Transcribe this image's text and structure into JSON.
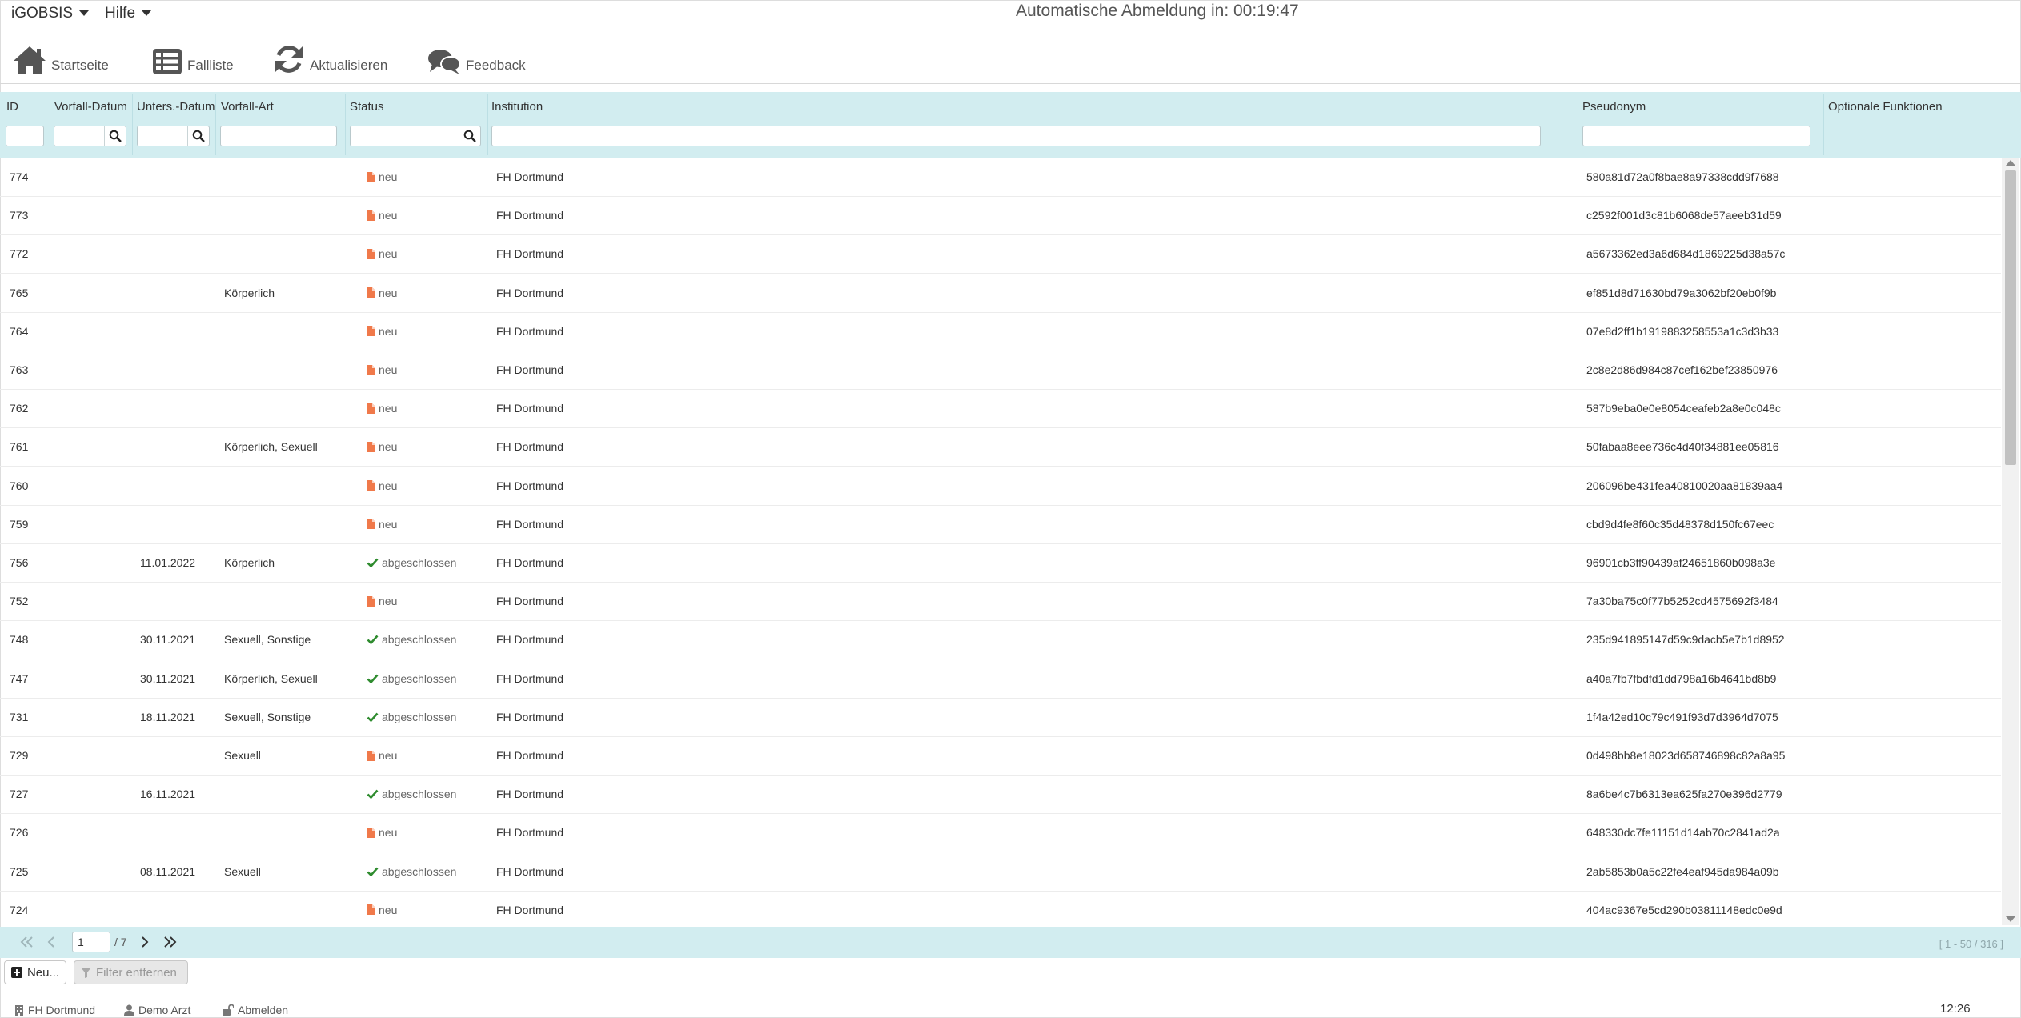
{
  "menubar": {
    "app_menu": "iGOBSIS",
    "help_menu": "Hilfe",
    "logout_timer": "Automatische Abmeldung in: 00:19:47"
  },
  "toolbar": {
    "home": "Startseite",
    "caselist": "Fallliste",
    "refresh": "Aktualisieren",
    "feedback": "Feedback"
  },
  "table": {
    "headers": {
      "id": "ID",
      "vorfall_datum": "Vorfall-Datum",
      "unters_datum": "Unters.-Datum",
      "vorfall_art": "Vorfall-Art",
      "status": "Status",
      "institution": "Institution",
      "pseudonym": "Pseudonym",
      "optionale": "Optionale Funktionen"
    },
    "rows": [
      {
        "id": "774",
        "vorfall": "",
        "unters": "",
        "art": "",
        "status": "neu",
        "status_type": "new",
        "institution": "FH Dortmund",
        "pseudonym": "580a81d72a0f8bae8a97338cdd9f7688"
      },
      {
        "id": "773",
        "vorfall": "",
        "unters": "",
        "art": "",
        "status": "neu",
        "status_type": "new",
        "institution": "FH Dortmund",
        "pseudonym": "c2592f001d3c81b6068de57aeeb31d59"
      },
      {
        "id": "772",
        "vorfall": "",
        "unters": "",
        "art": "",
        "status": "neu",
        "status_type": "new",
        "institution": "FH Dortmund",
        "pseudonym": "a5673362ed3a6d684d1869225d38a57c"
      },
      {
        "id": "765",
        "vorfall": "",
        "unters": "",
        "art": "Körperlich",
        "status": "neu",
        "status_type": "new",
        "institution": "FH Dortmund",
        "pseudonym": "ef851d8d71630bd79a3062bf20eb0f9b"
      },
      {
        "id": "764",
        "vorfall": "",
        "unters": "",
        "art": "",
        "status": "neu",
        "status_type": "new",
        "institution": "FH Dortmund",
        "pseudonym": "07e8d2ff1b1919883258553a1c3d3b33"
      },
      {
        "id": "763",
        "vorfall": "",
        "unters": "",
        "art": "",
        "status": "neu",
        "status_type": "new",
        "institution": "FH Dortmund",
        "pseudonym": "2c8e2d86d984c87cef162bef23850976"
      },
      {
        "id": "762",
        "vorfall": "",
        "unters": "",
        "art": "",
        "status": "neu",
        "status_type": "new",
        "institution": "FH Dortmund",
        "pseudonym": "587b9eba0e0e8054ceafeb2a8e0c048c"
      },
      {
        "id": "761",
        "vorfall": "",
        "unters": "",
        "art": "Körperlich, Sexuell",
        "status": "neu",
        "status_type": "new",
        "institution": "FH Dortmund",
        "pseudonym": "50fabaa8eee736c4d40f34881ee05816"
      },
      {
        "id": "760",
        "vorfall": "",
        "unters": "",
        "art": "",
        "status": "neu",
        "status_type": "new",
        "institution": "FH Dortmund",
        "pseudonym": "206096be431fea40810020aa81839aa4"
      },
      {
        "id": "759",
        "vorfall": "",
        "unters": "",
        "art": "",
        "status": "neu",
        "status_type": "new",
        "institution": "FH Dortmund",
        "pseudonym": "cbd9d4fe8f60c35d48378d150fc67eec"
      },
      {
        "id": "756",
        "vorfall": "",
        "unters": "11.01.2022",
        "art": "Körperlich",
        "status": "abgeschlossen",
        "status_type": "done",
        "institution": "FH Dortmund",
        "pseudonym": "96901cb3ff90439af24651860b098a3e"
      },
      {
        "id": "752",
        "vorfall": "",
        "unters": "",
        "art": "",
        "status": "neu",
        "status_type": "new",
        "institution": "FH Dortmund",
        "pseudonym": "7a30ba75c0f77b5252cd4575692f3484"
      },
      {
        "id": "748",
        "vorfall": "",
        "unters": "30.11.2021",
        "art": "Sexuell, Sonstige",
        "status": "abgeschlossen",
        "status_type": "done",
        "institution": "FH Dortmund",
        "pseudonym": "235d941895147d59c9dacb5e7b1d8952"
      },
      {
        "id": "747",
        "vorfall": "",
        "unters": "30.11.2021",
        "art": "Körperlich, Sexuell",
        "status": "abgeschlossen",
        "status_type": "done",
        "institution": "FH Dortmund",
        "pseudonym": "a40a7fb7fbdfd1dd798a16b4641bd8b9"
      },
      {
        "id": "731",
        "vorfall": "",
        "unters": "18.11.2021",
        "art": "Sexuell, Sonstige",
        "status": "abgeschlossen",
        "status_type": "done",
        "institution": "FH Dortmund",
        "pseudonym": "1f4a42ed10c79c491f93d7d3964d7075"
      },
      {
        "id": "729",
        "vorfall": "",
        "unters": "",
        "art": "Sexuell",
        "status": "neu",
        "status_type": "new",
        "institution": "FH Dortmund",
        "pseudonym": "0d498bb8e18023d658746898c82a8a95"
      },
      {
        "id": "727",
        "vorfall": "",
        "unters": "16.11.2021",
        "art": "",
        "status": "abgeschlossen",
        "status_type": "done",
        "institution": "FH Dortmund",
        "pseudonym": "8a6be4c7b6313ea625fa270e396d2779"
      },
      {
        "id": "726",
        "vorfall": "",
        "unters": "",
        "art": "",
        "status": "neu",
        "status_type": "new",
        "institution": "FH Dortmund",
        "pseudonym": "648330dc7fe11151d14ab70c2841ad2a"
      },
      {
        "id": "725",
        "vorfall": "",
        "unters": "08.11.2021",
        "art": "Sexuell",
        "status": "abgeschlossen",
        "status_type": "done",
        "institution": "FH Dortmund",
        "pseudonym": "2ab5853b0a5c22fe4eaf945da984a09b"
      },
      {
        "id": "724",
        "vorfall": "",
        "unters": "",
        "art": "",
        "status": "neu",
        "status_type": "new",
        "institution": "FH Dortmund",
        "pseudonym": "404ac9367e5cd290b03811148edc0e9d"
      }
    ]
  },
  "pager": {
    "page": "1",
    "total": "/ 7",
    "range": "[ 1 - 50 / 316 ]"
  },
  "actions": {
    "new": "Neu...",
    "remove_filter": "Filter entfernen"
  },
  "footer": {
    "institution": "FH Dortmund",
    "user": "Demo Arzt",
    "logout": "Abmelden",
    "clock": "12:26"
  },
  "colors": {
    "header_bg": "#d2edf0",
    "status_new": "#f0794a",
    "status_done": "#2e8b2e",
    "icon_gray": "#555555"
  },
  "icons": {
    "home": "home-icon",
    "caselist": "list-icon",
    "refresh": "refresh-icon",
    "feedback": "comments-icon",
    "search": "search-icon",
    "status_new": "file-icon",
    "status_done": "check-icon"
  }
}
